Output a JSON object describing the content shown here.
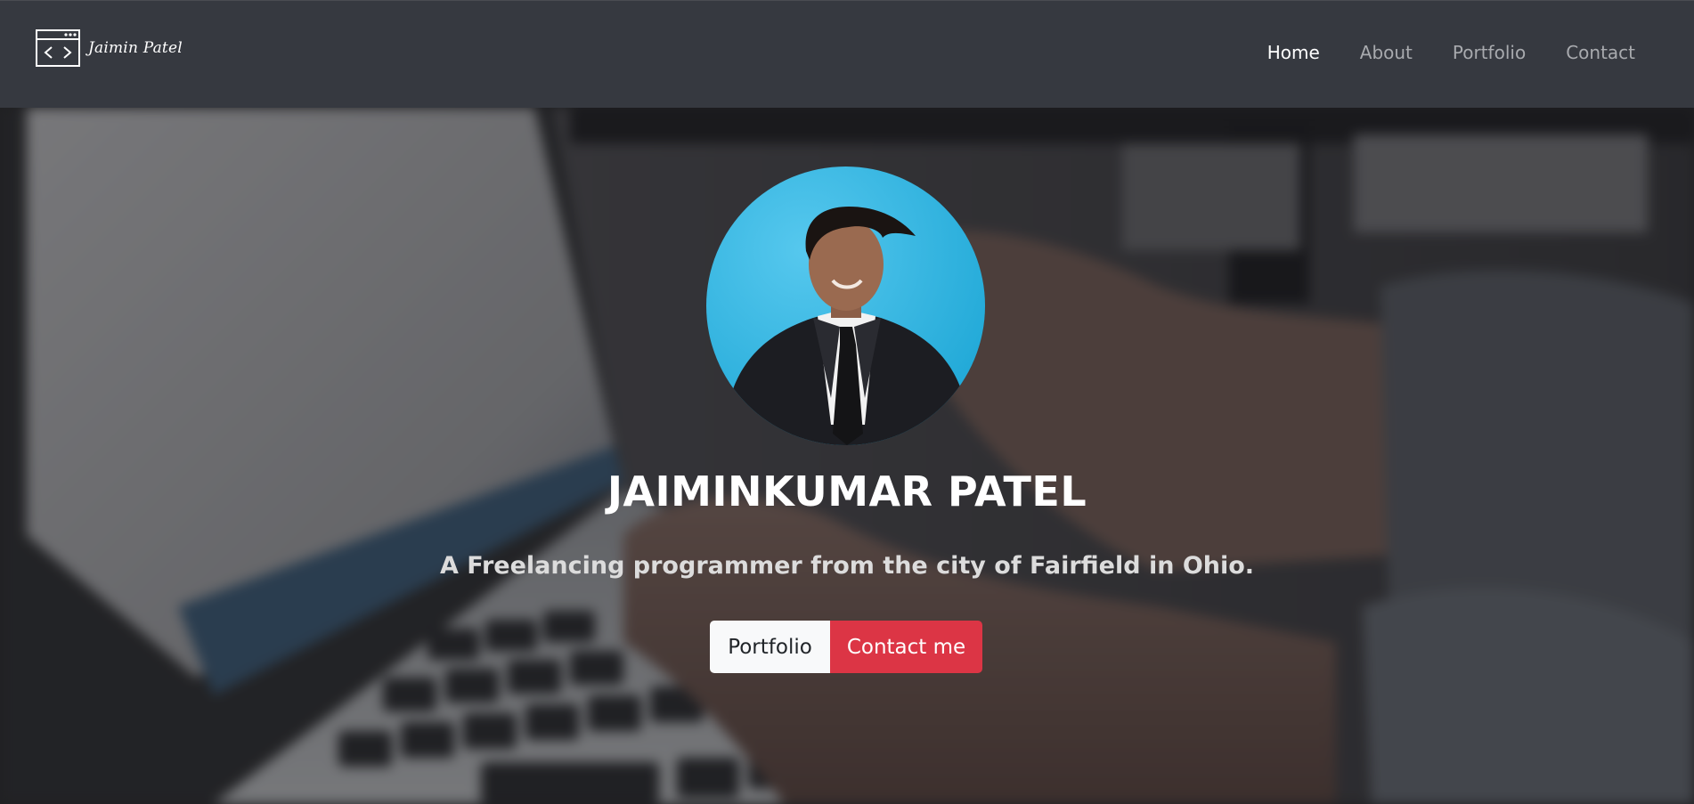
{
  "navbar": {
    "brand_text": "Jaimin Patel",
    "brand_icon": "code-window-icon",
    "links": [
      {
        "label": "Home",
        "active": true
      },
      {
        "label": "About",
        "active": false
      },
      {
        "label": "Portfolio",
        "active": false
      },
      {
        "label": "Contact",
        "active": false
      }
    ]
  },
  "hero": {
    "title": "JAIMINKUMAR PATEL",
    "subtitle": "A Freelancing programmer from the city of Fairfield in Ohio.",
    "buttons": {
      "portfolio_label": "Portfolio",
      "contact_label": "Contact me"
    }
  },
  "colors": {
    "navbar_bg": "#363940",
    "nav_active": "#ffffff",
    "nav_inactive": "#a8aaae",
    "btn_light": "#f8f9fa",
    "btn_danger": "#dc3545",
    "avatar_bg": "#2bb6e0"
  }
}
